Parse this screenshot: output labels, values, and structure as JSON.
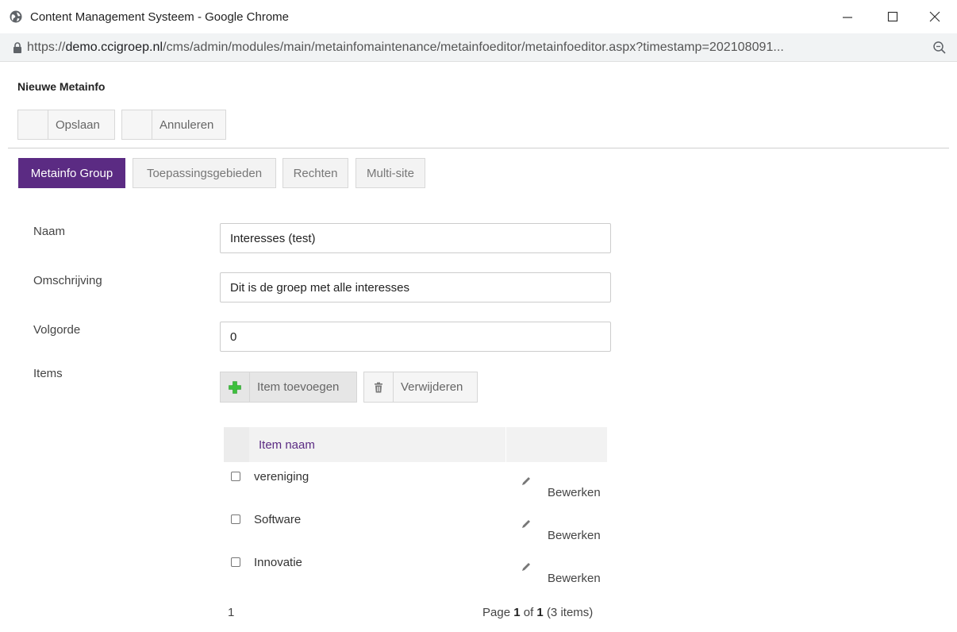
{
  "window": {
    "title": "Content Management Systeem - Google Chrome",
    "icon": "globe-icon",
    "controls": [
      "minimize-icon",
      "maximize-icon",
      "close-icon"
    ]
  },
  "address": {
    "url_prefix": "https://",
    "url_host": "demo.ccigroep.nl",
    "url_path": "/cms/admin/modules/main/metainfomaintenance/metainfoeditor/metainfoeditor.aspx?timestamp=202108091...",
    "lock_icon": "lock-icon",
    "zoom_icon": "zoom-icon"
  },
  "page": {
    "title": "Nieuwe Metainfo"
  },
  "toolbar": {
    "save_label": "Opslaan",
    "cancel_label": "Annuleren"
  },
  "tabs": [
    {
      "label": "Metainfo Group",
      "active": true
    },
    {
      "label": "Toepassingsgebieden",
      "active": false
    },
    {
      "label": "Rechten",
      "active": false
    },
    {
      "label": "Multi-site",
      "active": false
    }
  ],
  "form": {
    "name_label": "Naam",
    "name_value": "Interesses (test)",
    "description_label": "Omschrijving",
    "description_value": "Dit is de groep met alle interesses",
    "order_label": "Volgorde",
    "order_value": "0",
    "items_label": "Items"
  },
  "items": {
    "add_label": "Item toevoegen",
    "delete_label": "Verwijderen",
    "column_header": "Item naam",
    "rows": [
      {
        "name": "vereniging",
        "edit_label": "Bewerken"
      },
      {
        "name": "Software",
        "edit_label": "Bewerken"
      },
      {
        "name": "Innovatie",
        "edit_label": "Bewerken"
      }
    ],
    "pager": {
      "page_number": "1",
      "page_word": "Page",
      "current": "1",
      "of_word": "of",
      "total": "1",
      "count_text": "(3 items)"
    }
  },
  "colors": {
    "accent": "#5b2b83",
    "add_icon": "#3dbf3d"
  }
}
